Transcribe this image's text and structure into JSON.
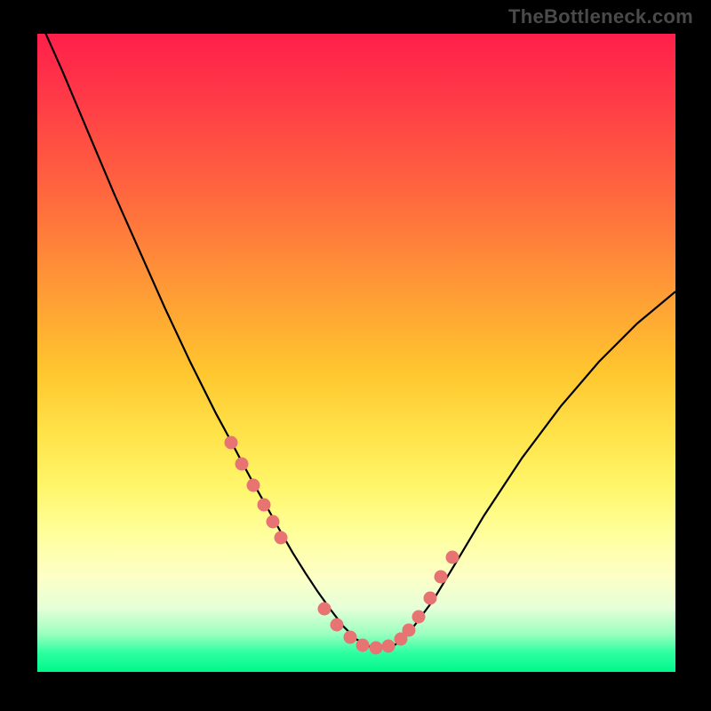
{
  "watermark": "TheBottleneck.com",
  "chart_data": {
    "type": "line",
    "title": "",
    "xlabel": "",
    "ylabel": "",
    "xlim": [
      0,
      100
    ],
    "ylim": [
      0,
      100
    ],
    "x": [
      0,
      4,
      8,
      12,
      16,
      20,
      24,
      28,
      30,
      32,
      34,
      36,
      38,
      40,
      42,
      44,
      46,
      48,
      50,
      52,
      54,
      56,
      58,
      62,
      66,
      70,
      76,
      82,
      88,
      94,
      100
    ],
    "y": [
      103,
      94,
      84.5,
      75,
      66,
      57,
      48.5,
      40.5,
      36.8,
      33,
      29.3,
      25.8,
      22.2,
      18.7,
      15.5,
      12.5,
      9.7,
      7.1,
      5.1,
      4.0,
      3.7,
      4.2,
      5.8,
      11.2,
      17.8,
      24.5,
      33.6,
      41.6,
      48.6,
      54.6,
      59.6
    ],
    "markers_x": [
      30.4,
      32.1,
      33.9,
      35.5,
      36.9,
      38.2,
      45.0,
      47.0,
      49.0,
      51.0,
      53.0,
      55.0,
      57.0,
      58.2,
      59.7,
      61.5,
      63.3,
      65.0
    ],
    "markers_y": [
      36.0,
      32.6,
      29.2,
      26.2,
      23.5,
      21.0,
      9.9,
      7.4,
      5.5,
      4.2,
      3.7,
      4.0,
      5.2,
      6.6,
      8.7,
      11.6,
      14.9,
      18.0
    ],
    "gradient_stops": [
      {
        "pos": 0,
        "color": "#ff1f4a"
      },
      {
        "pos": 26,
        "color": "#ff6a3e"
      },
      {
        "pos": 53,
        "color": "#ffc62e"
      },
      {
        "pos": 78,
        "color": "#ffff9a"
      },
      {
        "pos": 97,
        "color": "#2dffa0"
      },
      {
        "pos": 100,
        "color": "#00f78a"
      }
    ]
  }
}
